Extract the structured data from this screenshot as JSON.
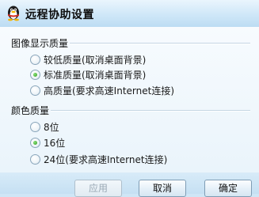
{
  "window": {
    "title": "远程协助设置"
  },
  "image_quality": {
    "heading": "图像显示质量",
    "options": [
      {
        "label": "较低质量(取消桌面背景)",
        "checked": false
      },
      {
        "label": "标准质量(取消桌面背景)",
        "checked": true
      },
      {
        "label": "高质量(要求高速Internet连接)",
        "checked": false
      }
    ]
  },
  "color_quality": {
    "heading": "颜色质量",
    "options": [
      {
        "label": "8位",
        "checked": false
      },
      {
        "label": "16位",
        "checked": true
      },
      {
        "label": "24位(要求高速Internet连接)",
        "checked": false
      }
    ]
  },
  "buttons": {
    "apply": "应用",
    "cancel": "取消",
    "ok": "确定"
  },
  "icons": {
    "app": "penguin-icon"
  }
}
